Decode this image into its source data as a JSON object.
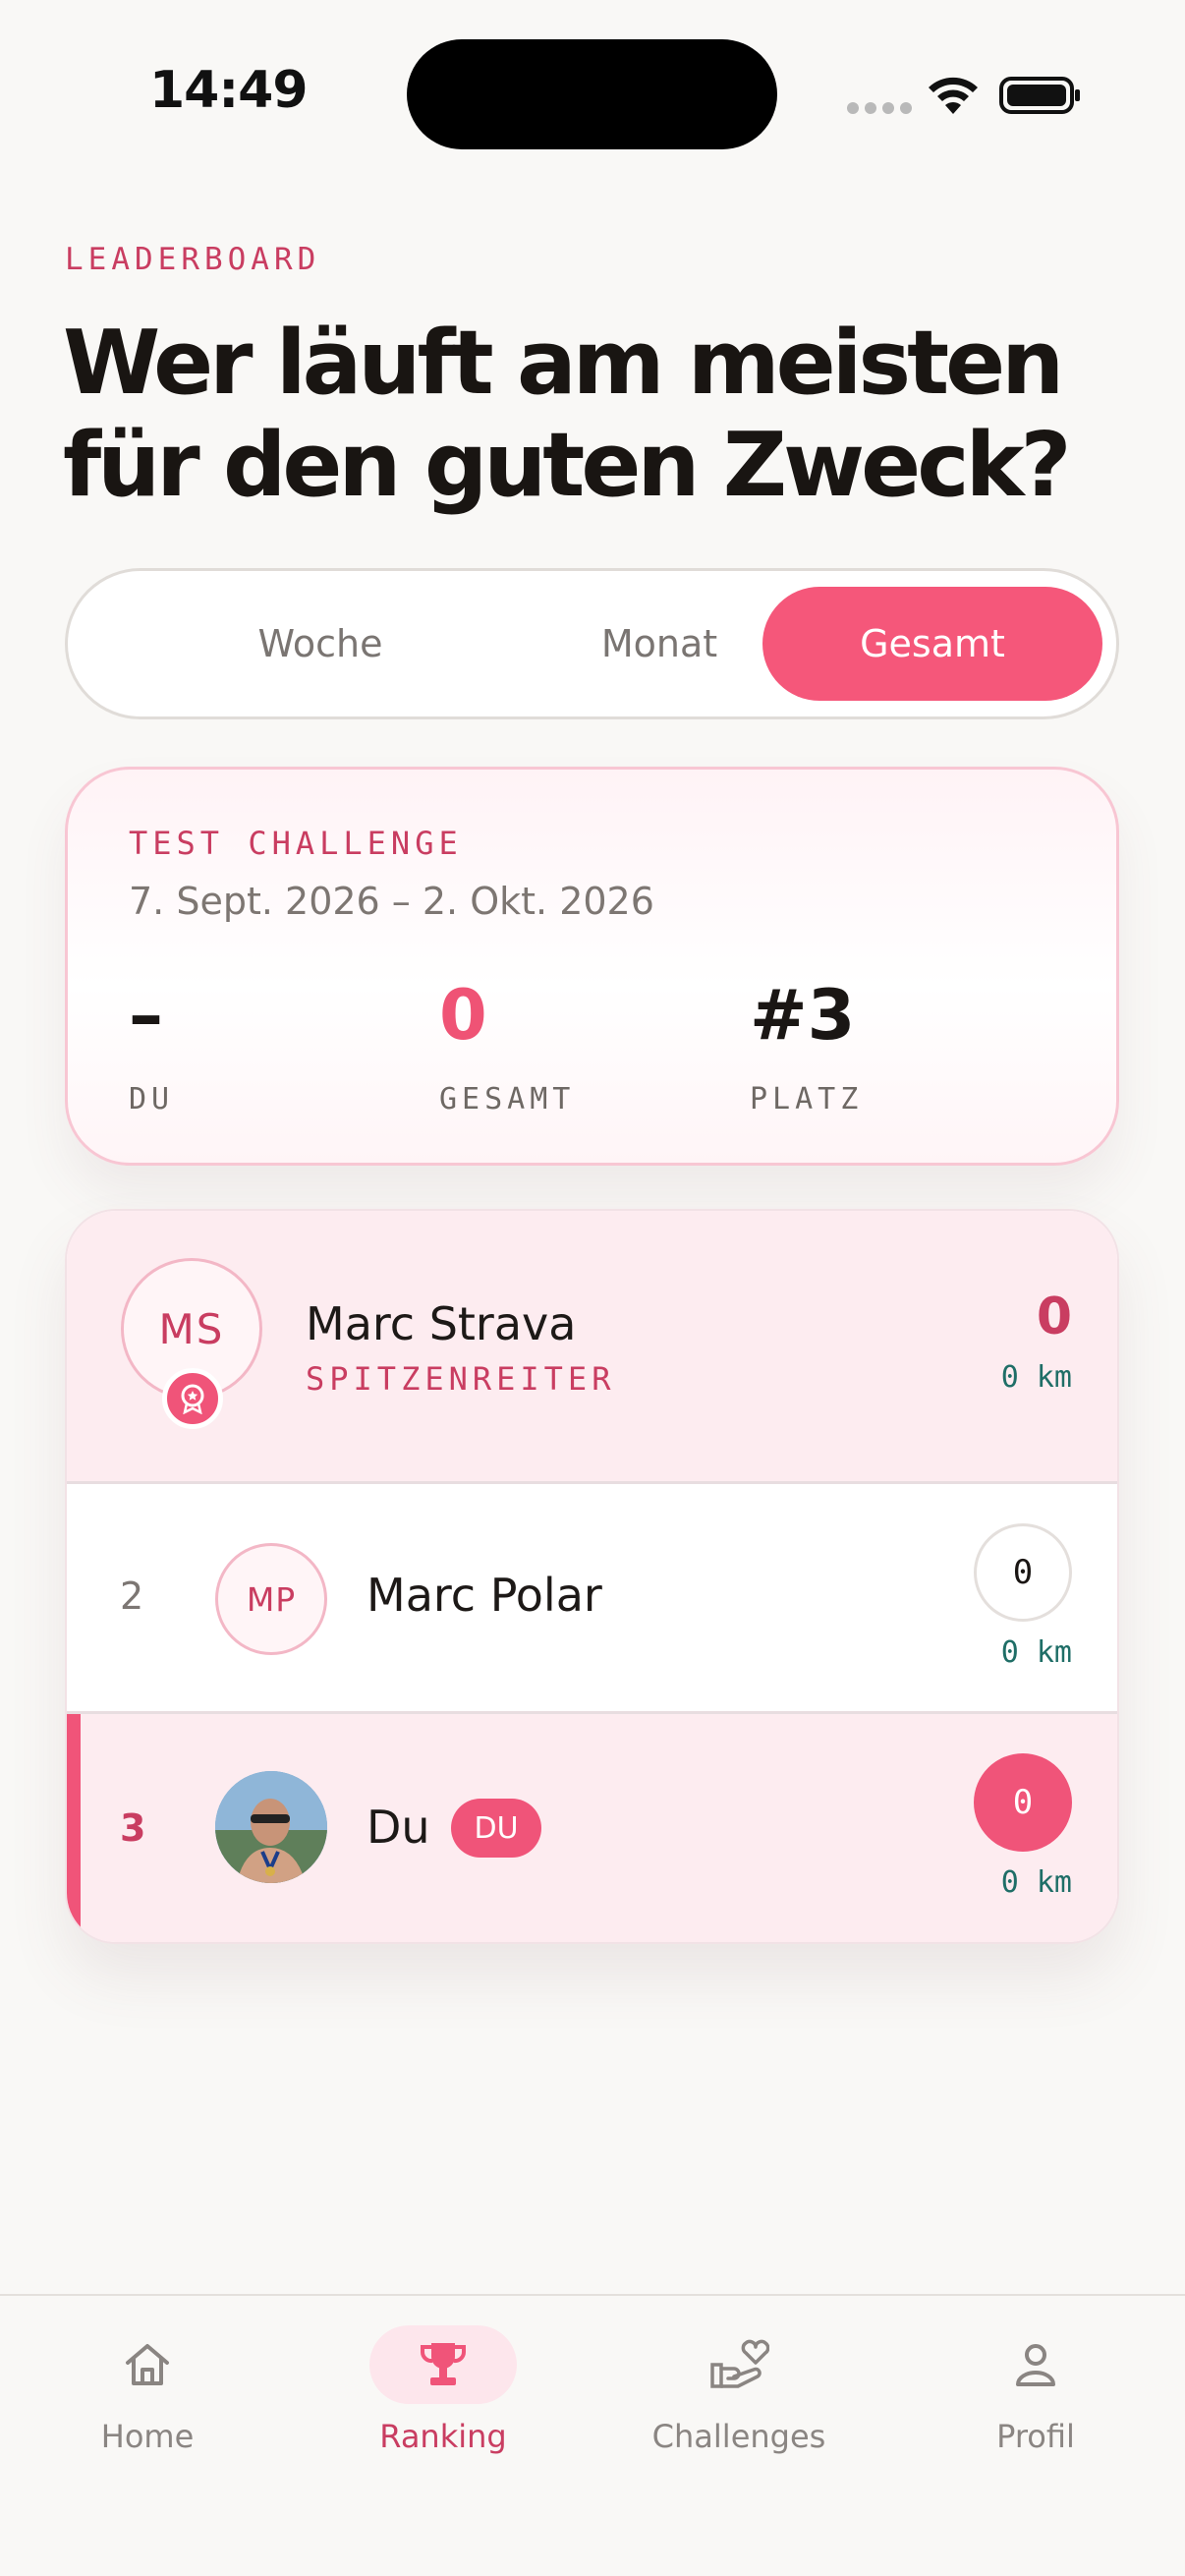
{
  "status_bar": {
    "time": "14:49"
  },
  "header": {
    "eyebrow": "LEADERBOARD",
    "headline_line1": "Wer läuft am meisten",
    "headline_line2": "für den guten Zweck?"
  },
  "period_tabs": [
    {
      "label": "Woche",
      "selected": false
    },
    {
      "label": "Monat",
      "selected": false
    },
    {
      "label": "Gesamt",
      "selected": true
    }
  ],
  "challenge": {
    "title": "TEST CHALLENGE",
    "dates": "7. Sept. 2026 – 2. Okt. 2026",
    "stats": [
      {
        "value": "–",
        "label": "DU"
      },
      {
        "value": "0",
        "label": "GESAMT"
      },
      {
        "value": "#3",
        "label": "PLATZ"
      }
    ]
  },
  "leaderboard": {
    "leader": {
      "initials": "MS",
      "name": "Marc Strava",
      "subtitle": "SPITZENREITER",
      "score": "0",
      "distance": "0 km"
    },
    "rows": [
      {
        "rank": "2",
        "initials": "MP",
        "name": "Marc Polar",
        "score": "0",
        "distance": "0 km",
        "is_self": false
      },
      {
        "rank": "3",
        "initials": "",
        "name": "Du",
        "badge": "DU",
        "score": "0",
        "distance": "0 km",
        "is_self": true
      }
    ]
  },
  "tabbar": {
    "items": [
      {
        "label": "Home",
        "icon": "home-icon",
        "active": false
      },
      {
        "label": "Ranking",
        "icon": "trophy-icon",
        "active": true
      },
      {
        "label": "Challenges",
        "icon": "heart-hand-icon",
        "active": false
      },
      {
        "label": "Profil",
        "icon": "person-icon",
        "active": false
      }
    ]
  },
  "colors": {
    "accent": "#f5577a",
    "accent_dark": "#c93d61",
    "teal": "#1f6e67",
    "background": "#f9f8f6"
  }
}
